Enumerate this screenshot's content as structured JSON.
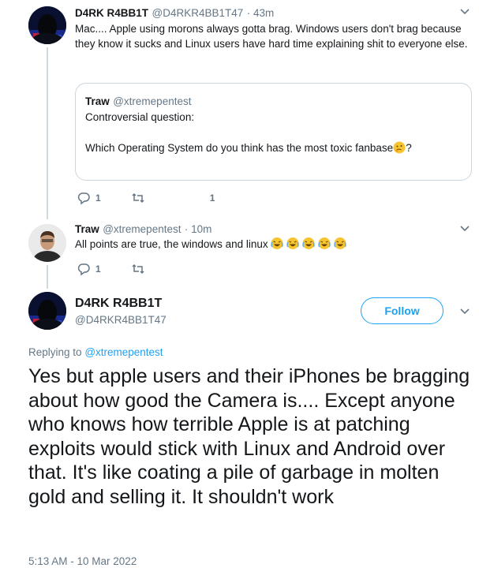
{
  "tweet1": {
    "name": "D4RK R4BB1T",
    "handle": "@D4RKR4BB1T47",
    "time": "· 43m",
    "text": "Mac.... Apple using morons always gotta brag. Windows users don't brag because they know it sucks and Linux users have hard time explaining shit to everyone else.",
    "quote": {
      "name": "Traw",
      "handle": "@xtremepentest",
      "line1": "Controversial question:",
      "line2": "Which Operating System  do you think has the most toxic fanbase",
      "line2_suffix": "?"
    },
    "reply_count": "1",
    "like_count": "1"
  },
  "tweet2": {
    "name": "Traw",
    "handle": "@xtremepentest",
    "time": "· 10m",
    "text": "All points are true, the windows and linux",
    "reply_count": "1"
  },
  "main": {
    "name": "D4RK R4BB1T",
    "handle": "@D4RKR4BB1T47",
    "follow_label": "Follow",
    "replying_prefix": "Replying to",
    "replying_to": "@xtremepentest",
    "text": "Yes but apple users and their iPhones be bragging about how good the Camera is.... Except anyone who knows how terrible Apple is at patching exploits would stick with Linux and Android over that. It's like coating a pile of garbage in molten gold and selling it. It shouldn't work",
    "timestamp": "5:13 AM - 10 Mar 2022"
  },
  "colors": {
    "accent": "#1da1f2",
    "muted": "#657786",
    "border": "#ccd6dd"
  },
  "icons": [
    "reply-icon",
    "retweet-icon",
    "like-icon",
    "chevron-down-icon",
    "thinking-emoji",
    "laughing-emoji"
  ]
}
